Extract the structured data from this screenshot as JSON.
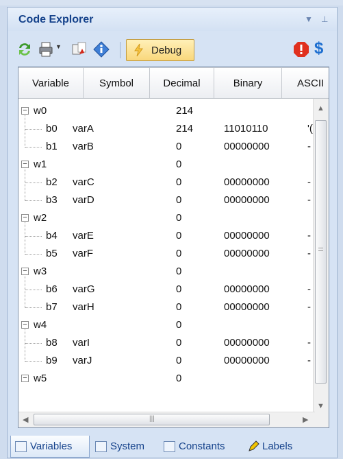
{
  "panel": {
    "title": "Code Explorer",
    "debug_label": "Debug"
  },
  "grid": {
    "columns": [
      "Variable",
      "Symbol",
      "Decimal",
      "Binary",
      "ASCII"
    ],
    "groups": [
      {
        "name": "w0",
        "decimal": "214",
        "bits": [
          {
            "name": "b0",
            "symbol": "varA",
            "decimal": "214",
            "binary": "11010110",
            "ascii": "'("
          },
          {
            "name": "b1",
            "symbol": "varB",
            "decimal": "0",
            "binary": "00000000",
            "ascii": "-"
          }
        ]
      },
      {
        "name": "w1",
        "decimal": "0",
        "bits": [
          {
            "name": "b2",
            "symbol": "varC",
            "decimal": "0",
            "binary": "00000000",
            "ascii": "-"
          },
          {
            "name": "b3",
            "symbol": "varD",
            "decimal": "0",
            "binary": "00000000",
            "ascii": "-"
          }
        ]
      },
      {
        "name": "w2",
        "decimal": "0",
        "bits": [
          {
            "name": "b4",
            "symbol": "varE",
            "decimal": "0",
            "binary": "00000000",
            "ascii": "-"
          },
          {
            "name": "b5",
            "symbol": "varF",
            "decimal": "0",
            "binary": "00000000",
            "ascii": "-"
          }
        ]
      },
      {
        "name": "w3",
        "decimal": "0",
        "bits": [
          {
            "name": "b6",
            "symbol": "varG",
            "decimal": "0",
            "binary": "00000000",
            "ascii": "-"
          },
          {
            "name": "b7",
            "symbol": "varH",
            "decimal": "0",
            "binary": "00000000",
            "ascii": "-"
          }
        ]
      },
      {
        "name": "w4",
        "decimal": "0",
        "bits": [
          {
            "name": "b8",
            "symbol": "varI",
            "decimal": "0",
            "binary": "00000000",
            "ascii": "-"
          },
          {
            "name": "b9",
            "symbol": "varJ",
            "decimal": "0",
            "binary": "00000000",
            "ascii": "-"
          }
        ]
      },
      {
        "name": "w5",
        "decimal": "0",
        "bits": []
      }
    ]
  },
  "tabs": [
    {
      "label": "Variables",
      "icon": "list-icon",
      "active": true
    },
    {
      "label": "System",
      "icon": "list-icon",
      "active": false
    },
    {
      "label": "Constants",
      "icon": "constants-icon",
      "active": false
    },
    {
      "label": "Labels",
      "icon": "pencil-icon",
      "active": false
    }
  ]
}
